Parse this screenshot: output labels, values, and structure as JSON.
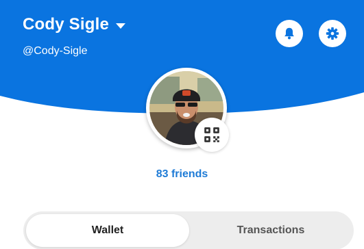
{
  "profile": {
    "name": "Cody Sigle",
    "handle": "@Cody-Sigle",
    "friends_label": "83 friends"
  },
  "header": {
    "accent_color": "#0a74e0",
    "icons": [
      "dropdown-caret-icon",
      "bell-icon",
      "gear-icon",
      "qr-code-icon"
    ]
  },
  "tabs": [
    {
      "label": "Wallet",
      "selected": true
    },
    {
      "label": "Transactions",
      "selected": false
    }
  ]
}
